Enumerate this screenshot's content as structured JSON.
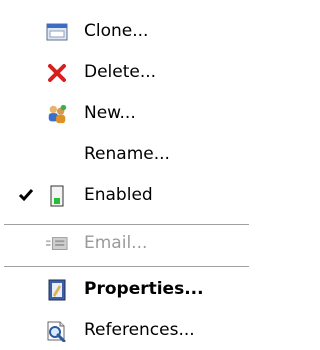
{
  "menu": {
    "items": [
      {
        "label": "Clone...",
        "icon": "clone-window-icon"
      },
      {
        "label": "Delete...",
        "icon": "delete-x-icon"
      },
      {
        "label": "New...",
        "icon": "new-users-icon"
      },
      {
        "label": "Rename...",
        "icon": ""
      },
      {
        "label": "Enabled",
        "icon": "enabled-status-icon",
        "checked": true
      },
      {
        "label": "Email...",
        "icon": "email-icon",
        "disabled": true
      },
      {
        "label": "Properties...",
        "icon": "properties-icon",
        "bold": true
      },
      {
        "label": "References...",
        "icon": "references-icon"
      }
    ]
  },
  "colors": {
    "text": "#000000",
    "disabled_text": "#9a9a9a",
    "separator": "#a0a0a0",
    "delete_red": "#d81e1e",
    "enabled_green": "#22c03a"
  }
}
